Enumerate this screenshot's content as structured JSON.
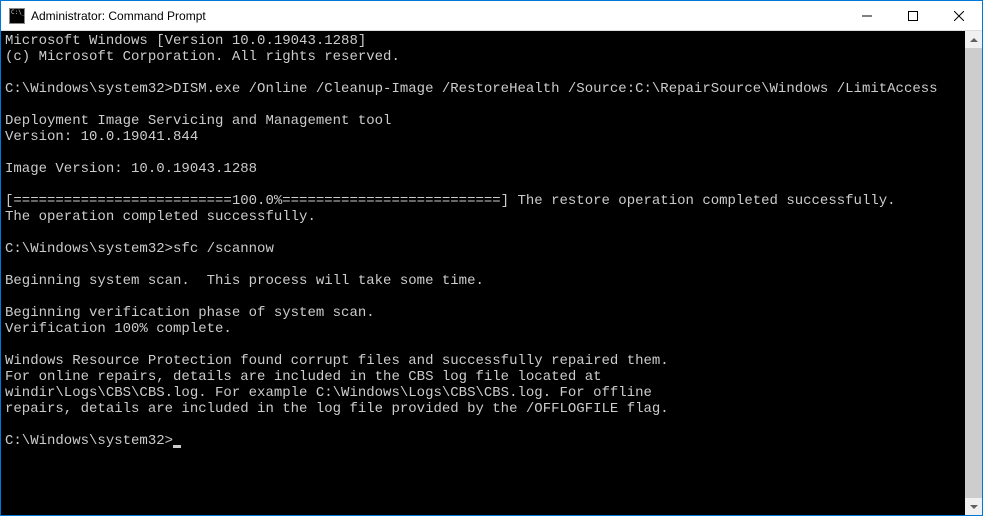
{
  "window": {
    "title": "Administrator: Command Prompt"
  },
  "terminal": {
    "lines": [
      "Microsoft Windows [Version 10.0.19043.1288]",
      "(c) Microsoft Corporation. All rights reserved.",
      "",
      "C:\\Windows\\system32>DISM.exe /Online /Cleanup-Image /RestoreHealth /Source:C:\\RepairSource\\Windows /LimitAccess",
      "",
      "Deployment Image Servicing and Management tool",
      "Version: 10.0.19041.844",
      "",
      "Image Version: 10.0.19043.1288",
      "",
      "[==========================100.0%==========================] The restore operation completed successfully.",
      "The operation completed successfully.",
      "",
      "C:\\Windows\\system32>sfc /scannow",
      "",
      "Beginning system scan.  This process will take some time.",
      "",
      "Beginning verification phase of system scan.",
      "Verification 100% complete.",
      "",
      "Windows Resource Protection found corrupt files and successfully repaired them.",
      "For online repairs, details are included in the CBS log file located at",
      "windir\\Logs\\CBS\\CBS.log. For example C:\\Windows\\Logs\\CBS\\CBS.log. For offline",
      "repairs, details are included in the log file provided by the /OFFLOGFILE flag.",
      "",
      "C:\\Windows\\system32>"
    ]
  }
}
